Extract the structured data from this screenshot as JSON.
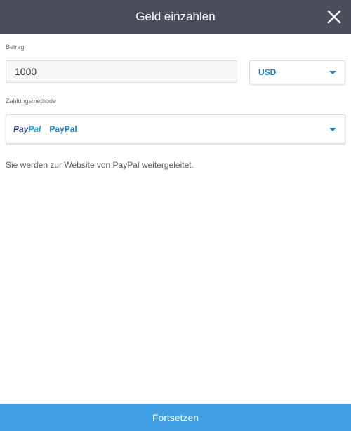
{
  "header": {
    "title": "Geld einzahlen",
    "close_icon": "close-icon"
  },
  "amount": {
    "label": "Betrag",
    "value": "1000"
  },
  "currency": {
    "selected": "USD"
  },
  "payment_method": {
    "label": "Zahlungsmethode",
    "logo_pay": "Pay",
    "logo_pal": "Pal",
    "selected": "PayPal"
  },
  "redirect_note": "Sie werden zur Website von PayPal weitergeleitet.",
  "continue_button": "Fortsetzen",
  "colors": {
    "header_bg": "#4a4f5b",
    "accent": "#1a7bc4",
    "button_bg": "#3f9ee3",
    "paypal_dark": "#253b80",
    "paypal_light": "#179bd7"
  }
}
